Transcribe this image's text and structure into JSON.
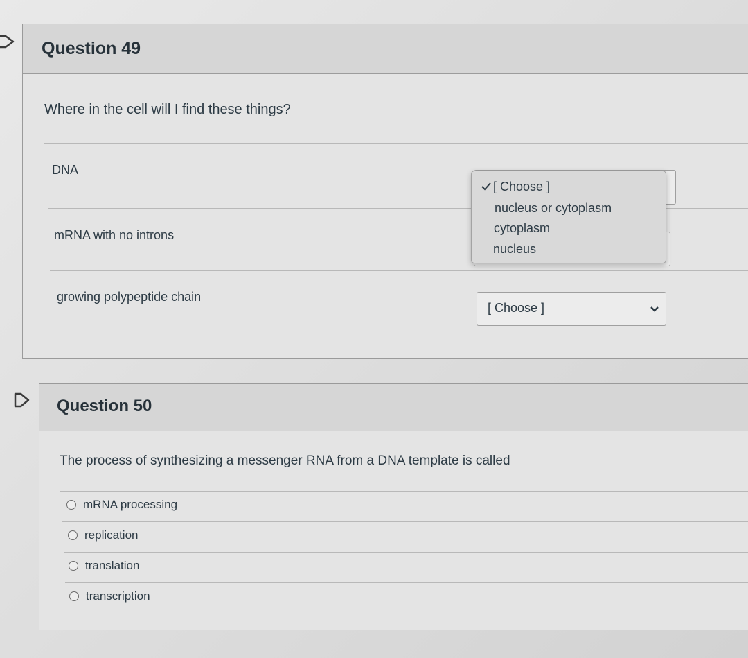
{
  "q49": {
    "title": "Question 49",
    "prompt": "Where in the cell will I find these things?",
    "rows": [
      {
        "label": "DNA",
        "select_value": "[ Choose ]"
      },
      {
        "label": "mRNA with no introns",
        "select_value": "[ Choose ]"
      },
      {
        "label": "growing polypeptide chain",
        "select_value": "[ Choose ]"
      }
    ],
    "dropdown": {
      "options": [
        "[ Choose ]",
        "nucleus or cytoplasm",
        "cytoplasm",
        "nucleus"
      ],
      "selected": "[ Choose ]"
    }
  },
  "q50": {
    "title": "Question 50",
    "prompt": "The process of synthesizing a messenger RNA from a DNA template is called",
    "choices": [
      "mRNA processing",
      "replication",
      "translation",
      "transcription"
    ]
  },
  "icons": {
    "flag": "flag-icon",
    "checkmark": "checkmark-icon",
    "chevron": "chevron-down-icon"
  }
}
